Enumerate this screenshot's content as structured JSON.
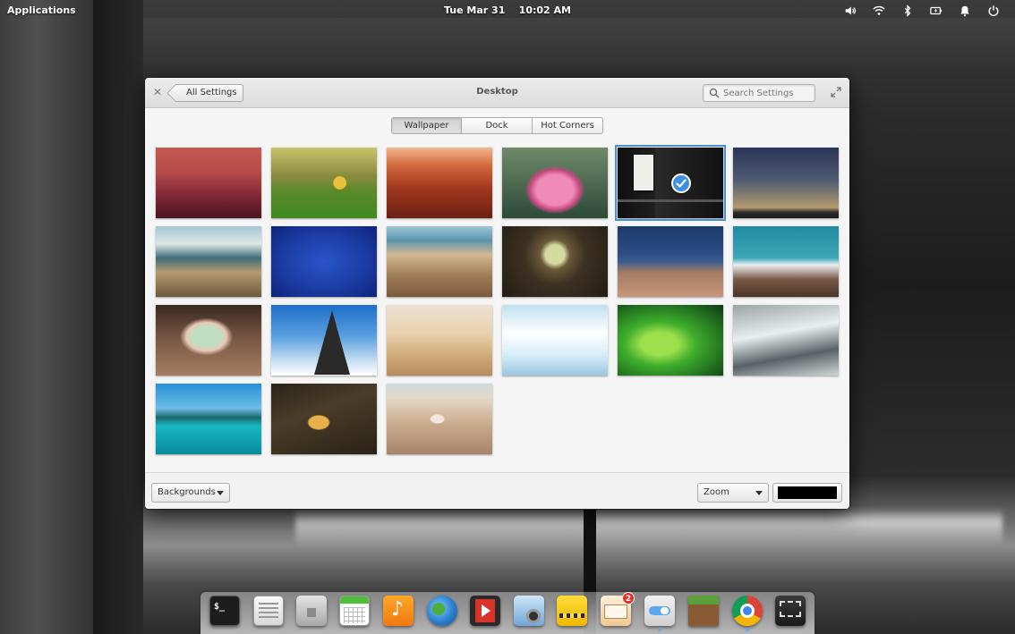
{
  "top_panel": {
    "applications_label": "Applications",
    "clock": "Tue Mar 31    10:02 AM",
    "indicators": [
      "volume-icon",
      "wifi-icon",
      "bluetooth-icon",
      "battery-icon",
      "notification-icon",
      "power-icon"
    ]
  },
  "window": {
    "title": "Desktop",
    "back_label": "All Settings",
    "search_placeholder": "Search Settings",
    "tabs": [
      {
        "label": "Wallpaper",
        "active": true
      },
      {
        "label": "Dock",
        "active": false
      },
      {
        "label": "Hot Corners",
        "active": false
      }
    ],
    "wallpapers": [
      {
        "name": "red-forest-wallpaper"
      },
      {
        "name": "green-meadow-leaf-wallpaper"
      },
      {
        "name": "red-canyon-wallpaper"
      },
      {
        "name": "pink-lotus-wallpaper"
      },
      {
        "name": "paper-note-wallpaper",
        "selected": true
      },
      {
        "name": "dusk-sky-wallpaper"
      },
      {
        "name": "coastal-fence-wallpaper"
      },
      {
        "name": "blue-pattern-wallpaper"
      },
      {
        "name": "rocky-shore-wallpaper"
      },
      {
        "name": "wooden-tunnel-wallpaper"
      },
      {
        "name": "boardwalk-sea-wallpaper"
      },
      {
        "name": "snowy-mountain-wallpaper"
      },
      {
        "name": "succulent-pebbles-wallpaper"
      },
      {
        "name": "eiffel-tower-wallpaper"
      },
      {
        "name": "sand-dunes-wallpaper"
      },
      {
        "name": "clouds-wallpaper"
      },
      {
        "name": "green-fern-wallpaper"
      },
      {
        "name": "metal-texture-wallpaper"
      },
      {
        "name": "tropical-lake-wallpaper"
      },
      {
        "name": "autumn-leaves-wallpaper"
      },
      {
        "name": "seashell-beach-wallpaper"
      }
    ],
    "bottom": {
      "source_dropdown": "Backgrounds",
      "mode_dropdown": "Zoom",
      "background_color": "#000000"
    }
  },
  "dock": {
    "items": [
      {
        "name": "terminal-icon",
        "label": "$_"
      },
      {
        "name": "text-editor-icon"
      },
      {
        "name": "files-icon"
      },
      {
        "name": "calendar-icon"
      },
      {
        "name": "music-icon"
      },
      {
        "name": "web-browser-icon"
      },
      {
        "name": "video-player-icon"
      },
      {
        "name": "photos-icon"
      },
      {
        "name": "taxi-icon"
      },
      {
        "name": "mail-icon",
        "badge": "2"
      },
      {
        "name": "switchboard-icon"
      },
      {
        "name": "minecraft-icon"
      },
      {
        "name": "chrome-icon"
      },
      {
        "name": "screenshot-icon"
      }
    ]
  }
}
